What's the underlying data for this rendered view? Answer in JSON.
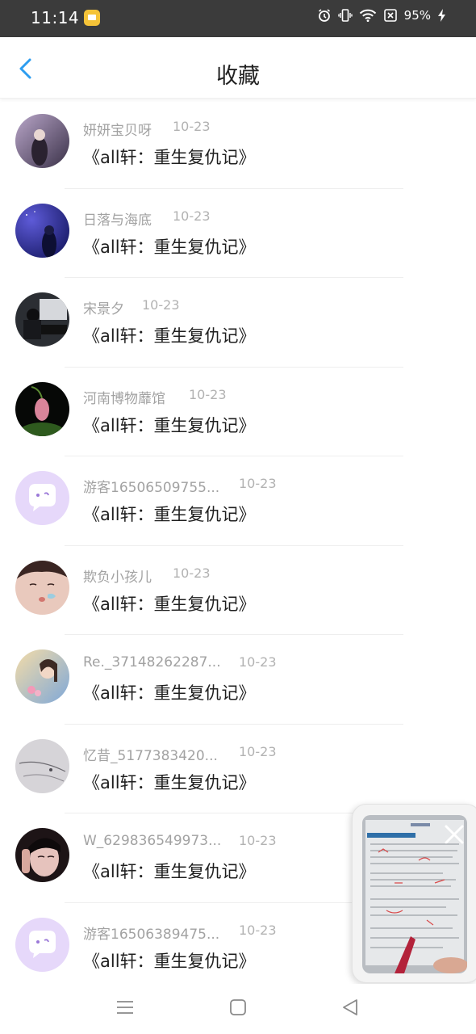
{
  "status_bar": {
    "time": "11:14",
    "battery_percent": "95%"
  },
  "header": {
    "title": "收藏",
    "back_icon": "chevron-left-icon",
    "accent_color": "#2d9df0"
  },
  "favorites": [
    {
      "username": "妍妍宝贝呀",
      "date": "10-23",
      "title": "《all轩：重生复仇记》"
    },
    {
      "username": "日落与海底",
      "date": "10-23",
      "title": "《all轩：重生复仇记》"
    },
    {
      "username": "宋景夕",
      "date": "10-23",
      "title": "《all轩：重生复仇记》"
    },
    {
      "username": "河南博物蘼馆",
      "date": "10-23",
      "title": "《all轩：重生复仇记》"
    },
    {
      "username": "游客16506509755...",
      "date": "10-23",
      "title": "《all轩：重生复仇记》"
    },
    {
      "username": "欺负小孩儿",
      "date": "10-23",
      "title": "《all轩：重生复仇记》"
    },
    {
      "username": "Re._37148262287...",
      "date": "10-23",
      "title": "《all轩：重生复仇记》"
    },
    {
      "username": "忆昔_5177383420...",
      "date": "10-23",
      "title": "《all轩：重生复仇记》"
    },
    {
      "username": "W_629836549973...",
      "date": "10-23",
      "title": "《all轩：重生复仇记》"
    },
    {
      "username": "游客16506389475...",
      "date": "10-23",
      "title": "《all轩：重生复仇记》"
    }
  ],
  "float_window": {
    "close_icon": "close-icon"
  },
  "nav_bar": {
    "menu_icon": "menu-icon",
    "home_icon": "square-home-icon",
    "back_icon": "triangle-back-icon"
  }
}
